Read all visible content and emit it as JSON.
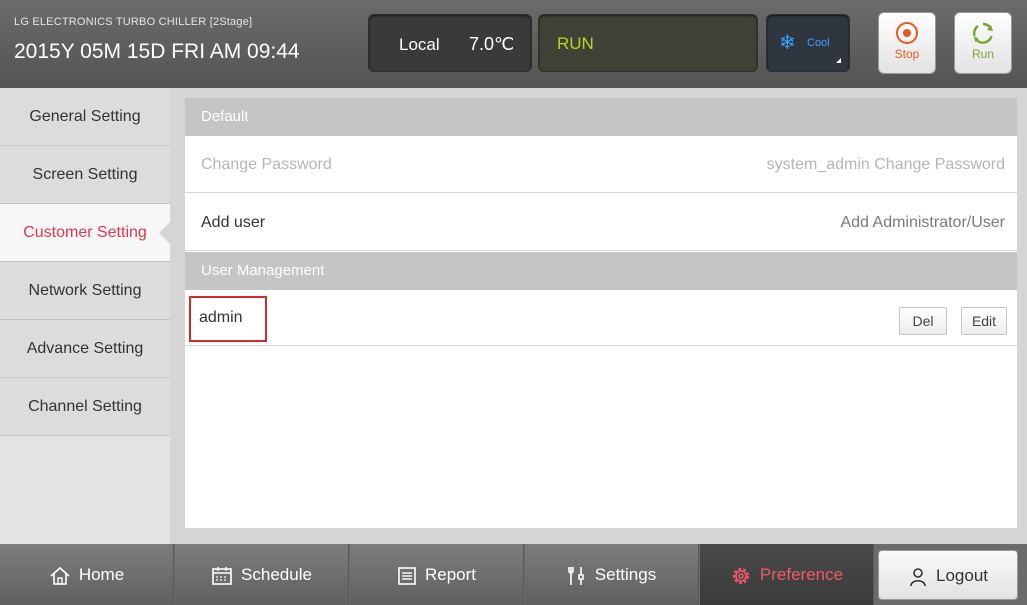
{
  "header": {
    "subtitle": "LG ELECTRONICS TURBO CHILLER [2Stage]",
    "datetime": "2015Y 05M 15D  FRI AM 09:44",
    "mode": "Local",
    "temperature": "7.0℃",
    "status": "RUN",
    "cool_label": "Cool",
    "stop_label": "Stop",
    "run_label": "Run"
  },
  "sidebar": {
    "items": [
      {
        "label": "General Setting"
      },
      {
        "label": "Screen Setting"
      },
      {
        "label": "Customer Setting",
        "active": true
      },
      {
        "label": "Network Setting"
      },
      {
        "label": "Advance Setting"
      },
      {
        "label": "Channel Setting"
      }
    ]
  },
  "main": {
    "default_header": "Default",
    "change_password": {
      "label": "Change Password",
      "value": "system_admin Change Password"
    },
    "add_user": {
      "label": "Add user",
      "value": "Add Administrator/User"
    },
    "user_mgmt_header": "User Management",
    "users": [
      {
        "name": "admin",
        "del_label": "Del",
        "edit_label": "Edit"
      }
    ]
  },
  "nav": {
    "home": "Home",
    "schedule": "Schedule",
    "report": "Report",
    "settings": "Settings",
    "preference": "Preference",
    "logout": "Logout"
  },
  "colors": {
    "active_text": "#e0364e",
    "run_status": "#b9d22a",
    "cool": "#37a3ff",
    "selection_box": "#d62a2a"
  }
}
